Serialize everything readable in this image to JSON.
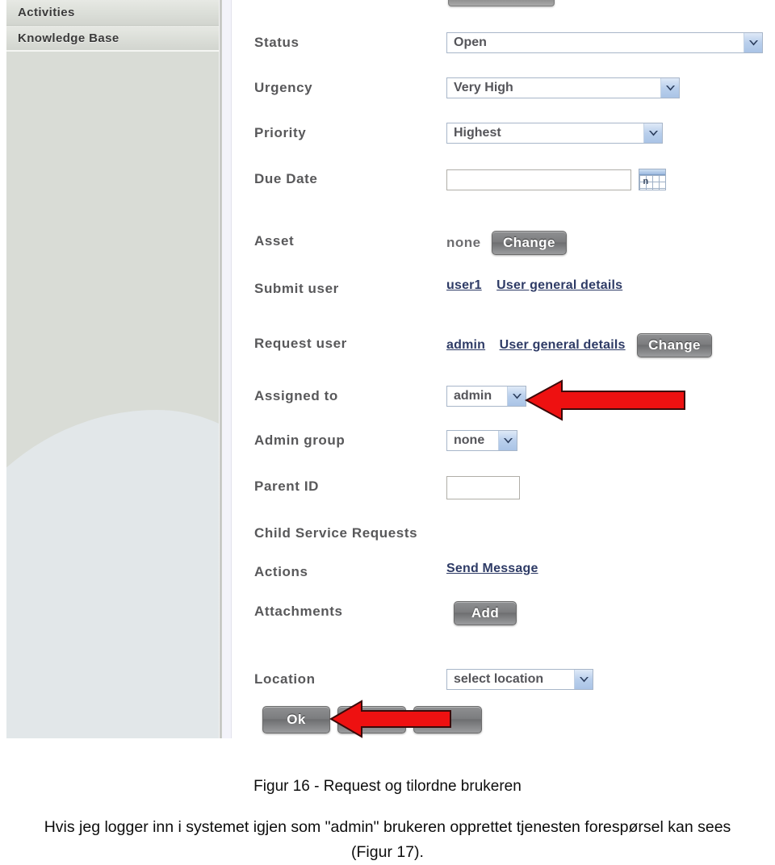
{
  "sidebar": {
    "items": [
      {
        "label": "Activities"
      },
      {
        "label": "Knowledge Base"
      }
    ]
  },
  "form": {
    "fields": [
      {
        "label": "Status",
        "type": "select",
        "value": "Open"
      },
      {
        "label": "Urgency",
        "type": "select",
        "value": "Very High"
      },
      {
        "label": "Priority",
        "type": "select",
        "value": "Highest"
      },
      {
        "label": "Due Date",
        "type": "date",
        "value": "",
        "icon": "calendar-icon"
      },
      {
        "label": "Asset",
        "type": "value-button",
        "value": "none",
        "button": "Change"
      },
      {
        "label": "Submit user",
        "type": "links",
        "value": "user1",
        "link": "User general details"
      },
      {
        "label": "Request user",
        "type": "links-button",
        "value": "admin",
        "link": "User general details",
        "button": "Change"
      },
      {
        "label": "Assigned to",
        "type": "select",
        "value": "admin"
      },
      {
        "label": "Admin group",
        "type": "select",
        "value": "none"
      },
      {
        "label": "Parent ID",
        "type": "text",
        "value": ""
      },
      {
        "label": "Child Service Requests",
        "type": "empty",
        "value": ""
      },
      {
        "label": "Actions",
        "type": "link",
        "link": "Send Message"
      },
      {
        "label": "Attachments",
        "type": "button",
        "button": "Add"
      },
      {
        "label": "Location",
        "type": "select",
        "value": "select location"
      }
    ],
    "footer_buttons": [
      {
        "label": "Ok"
      },
      {
        "label": ""
      },
      {
        "label": ""
      }
    ]
  },
  "annotations": {
    "arrow_color": "#ee1111",
    "arrows": [
      {
        "name": "arrow-assigned-to"
      },
      {
        "name": "arrow-ok-button"
      }
    ]
  },
  "caption": {
    "figure": "Figur 16 - Request og tilordne brukeren",
    "paragraph": "Hvis jeg logger inn i systemet igjen som \"admin\" brukeren opprettet tjenesten forespørsel kan sees (Figur 17)."
  },
  "colors": {
    "sidebar_bg": "#d9dcd6",
    "sidebar_accent": "#e2e7e9",
    "select_border": "#a8b6c9",
    "link": "#2e3b66",
    "label": "#58585a",
    "button_bg": "#7c7d7f"
  }
}
